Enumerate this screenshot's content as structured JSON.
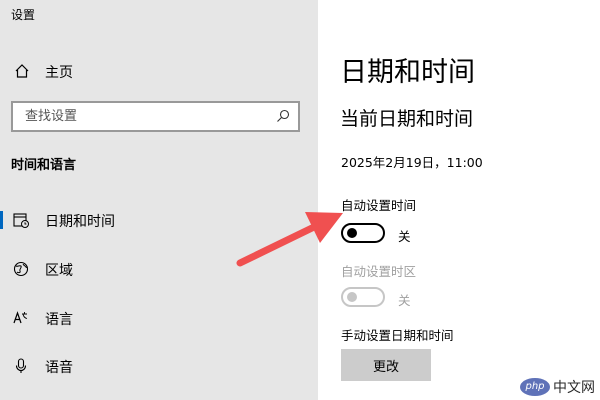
{
  "window": {
    "title": "设置"
  },
  "sidebar": {
    "home_label": "主页",
    "search": {
      "placeholder": "查找设置"
    },
    "section_header": "时间和语言",
    "items": [
      {
        "label": "日期和时间",
        "icon": "calendar-clock-icon",
        "selected": true
      },
      {
        "label": "区域",
        "icon": "globe-icon",
        "selected": false
      },
      {
        "label": "语言",
        "icon": "language-icon",
        "selected": false
      },
      {
        "label": "语音",
        "icon": "microphone-icon",
        "selected": false
      }
    ]
  },
  "main": {
    "page_title": "日期和时间",
    "sub_title": "当前日期和时间",
    "current_datetime": "2025年2月19日，11:00",
    "auto_time": {
      "label": "自动设置时间",
      "state": "关",
      "on": false,
      "enabled": true
    },
    "auto_timezone": {
      "label": "自动设置时区",
      "state": "关",
      "on": false,
      "enabled": false
    },
    "manual": {
      "label": "手动设置日期和时间",
      "button_label": "更改"
    }
  },
  "annotation": {
    "arrow_color": "#f05050"
  },
  "watermark": {
    "badge": "php",
    "text": "中文网"
  },
  "colors": {
    "sidebar_bg": "#e6e6e6",
    "accent": "#0067c0",
    "button_bg": "#cccccc"
  }
}
